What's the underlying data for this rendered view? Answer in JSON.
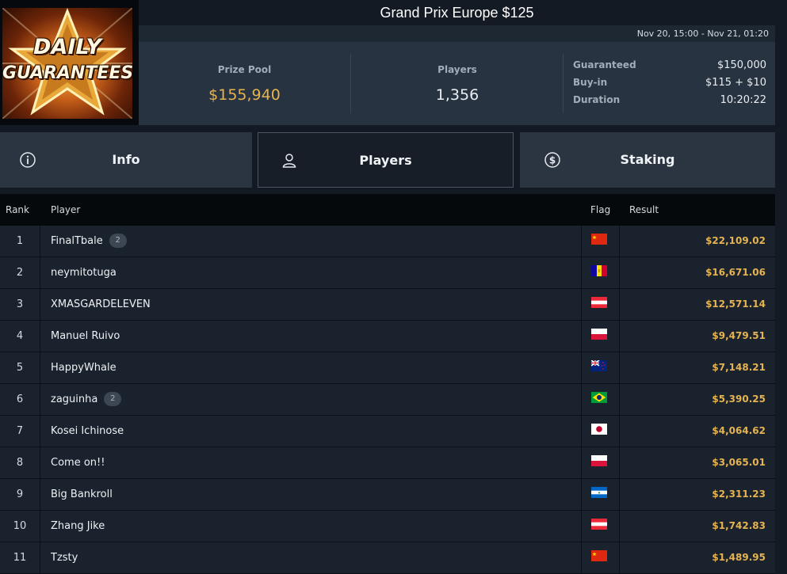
{
  "logo": {
    "line1": "DAILY",
    "line2": "GUARANTEES"
  },
  "tournament": {
    "title": "Grand Prix Europe $125",
    "dates": "Nov 20, 15:00 - Nov 21, 01:20"
  },
  "stats": {
    "prize_pool_label": "Prize Pool",
    "prize_pool_value": "$155,940",
    "players_label": "Players",
    "players_value": "1,356"
  },
  "details": {
    "guaranteed_label": "Guaranteed",
    "guaranteed_value": "$150,000",
    "buyin_label": "Buy-in",
    "buyin_value": "$115 + $10",
    "duration_label": "Duration",
    "duration_value": "10:20:22"
  },
  "tabs": [
    {
      "label": "Info",
      "icon": "info-icon"
    },
    {
      "label": "Players",
      "icon": "user-icon"
    },
    {
      "label": "Staking",
      "icon": "dollar-coin-icon"
    }
  ],
  "table": {
    "headers": {
      "rank": "Rank",
      "player": "Player",
      "flag": "Flag",
      "result": "Result"
    },
    "rows": [
      {
        "rank": "1",
        "player": "FinalTbale",
        "badge": "2",
        "flag": "china",
        "result": "$22,109.02"
      },
      {
        "rank": "2",
        "player": "neymitotuga",
        "badge": "",
        "flag": "andorra",
        "result": "$16,671.06"
      },
      {
        "rank": "3",
        "player": "XMASGARDELEVEN",
        "badge": "",
        "flag": "austria",
        "result": "$12,571.14"
      },
      {
        "rank": "4",
        "player": "Manuel Ruivo",
        "badge": "",
        "flag": "poland",
        "result": "$9,479.51"
      },
      {
        "rank": "5",
        "player": "HappyWhale",
        "badge": "",
        "flag": "new-zealand",
        "result": "$7,148.21"
      },
      {
        "rank": "6",
        "player": "zaguinha",
        "badge": "2",
        "flag": "brazil",
        "result": "$5,390.25"
      },
      {
        "rank": "7",
        "player": "Kosei Ichinose",
        "badge": "",
        "flag": "japan",
        "result": "$4,064.62"
      },
      {
        "rank": "8",
        "player": "Come on!!",
        "badge": "",
        "flag": "poland",
        "result": "$3,065.01"
      },
      {
        "rank": "9",
        "player": "Big Bankroll",
        "badge": "",
        "flag": "nicaragua",
        "result": "$2,311.23"
      },
      {
        "rank": "10",
        "player": "Zhang Jike",
        "badge": "",
        "flag": "austria",
        "result": "$1,742.83"
      },
      {
        "rank": "11",
        "player": "Tzsty",
        "badge": "",
        "flag": "china",
        "result": "$1,489.95"
      }
    ]
  },
  "colors": {
    "gold": "#e5b351",
    "panel": "#273340",
    "background": "#131a23"
  }
}
